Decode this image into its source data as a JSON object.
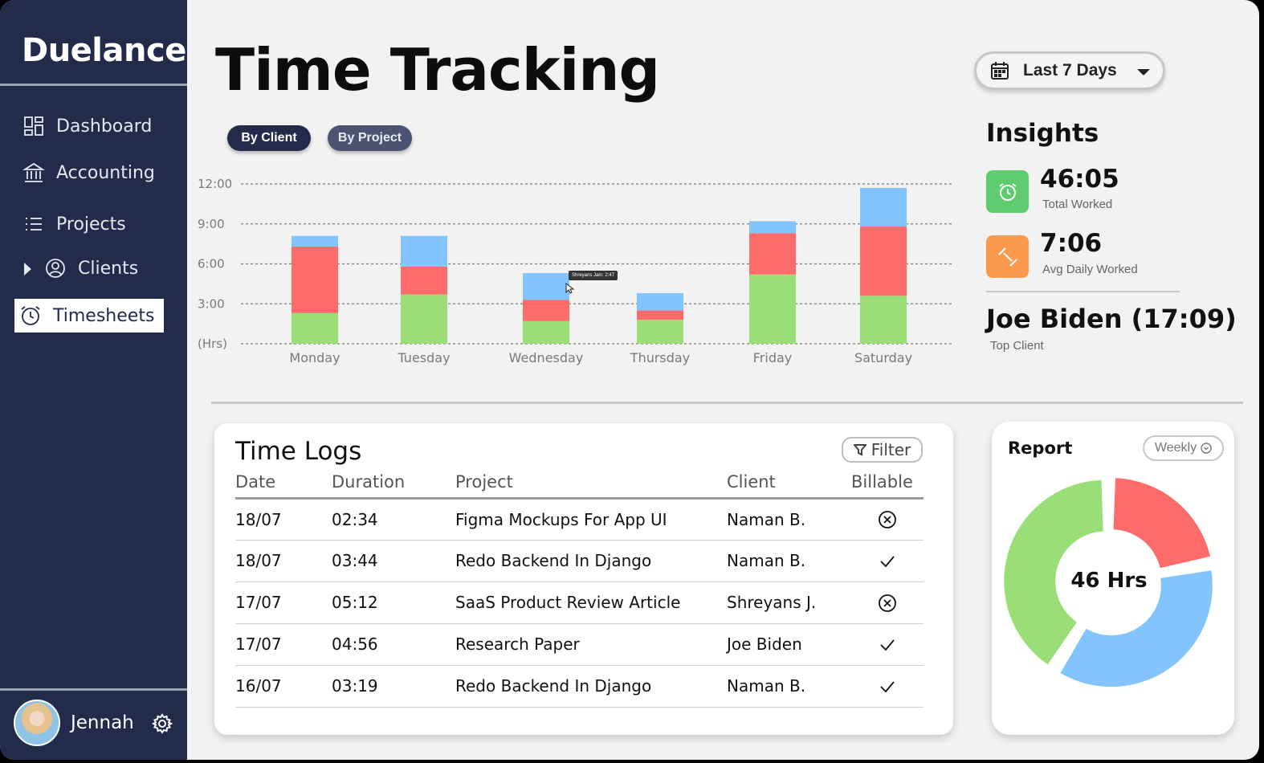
{
  "sidebar": {
    "brand": "Duelance",
    "items": [
      {
        "label": "Dashboard"
      },
      {
        "label": "Accounting"
      },
      {
        "label": "Projects"
      },
      {
        "label": "Clients"
      },
      {
        "label": "Timesheets"
      }
    ],
    "user": {
      "name": "Jennah"
    }
  },
  "header": {
    "title": "Time Tracking",
    "date_range": "Last 7 Days",
    "tabs": [
      {
        "label": "By Client",
        "active": true
      },
      {
        "label": "By Project",
        "active": false
      }
    ]
  },
  "colors": {
    "green": "#9ade78",
    "red": "#fe6b6b",
    "blue": "#82c4fe",
    "navy": "#222b4a",
    "insight_green": "#5ecb6f",
    "insight_orange": "#f99a4f"
  },
  "chart_data": {
    "type": "bar",
    "stacked": true,
    "categories": [
      "Monday",
      "Tuesday",
      "Wednesday",
      "Thursday",
      "Friday",
      "Saturday"
    ],
    "y_ticks": [
      "12:00",
      "9:00",
      "6:00",
      "3:00",
      "(Hrs)"
    ],
    "ylim": [
      0,
      12
    ],
    "grid": true,
    "series": [
      {
        "color": "#9ade78",
        "values": [
          2.3,
          3.7,
          1.7,
          1.8,
          5.2,
          3.6
        ]
      },
      {
        "color": "#fe6b6b",
        "values": [
          5.0,
          2.1,
          1.6,
          0.7,
          3.1,
          5.2
        ]
      },
      {
        "color": "#82c4fe",
        "values": [
          0.8,
          2.3,
          2.0,
          1.3,
          0.9,
          2.9
        ]
      }
    ],
    "tooltip": "Shreyans Jain: 2:47"
  },
  "insights": {
    "title": "Insights",
    "total_worked": {
      "value": "46:05",
      "label": "Total Worked"
    },
    "avg_daily": {
      "value": "7:06",
      "label": "Avg Daily Worked"
    },
    "top_client": {
      "value": "Joe Biden (17:09)",
      "label": "Top Client"
    }
  },
  "time_logs": {
    "title": "Time Logs",
    "filter_label": "Filter",
    "columns": [
      "Date",
      "Duration",
      "Project",
      "Client",
      "Billable"
    ],
    "rows": [
      {
        "date": "18/07",
        "duration": "02:34",
        "project": "Figma Mockups For App UI",
        "client": "Naman B.",
        "billable": false
      },
      {
        "date": "18/07",
        "duration": "03:44",
        "project": "Redo Backend In Django",
        "client": "Naman B.",
        "billable": true
      },
      {
        "date": "17/07",
        "duration": "05:12",
        "project": "SaaS Product Review Article",
        "client": "Shreyans J.",
        "billable": false
      },
      {
        "date": "17/07",
        "duration": "04:56",
        "project": "Research Paper",
        "client": "Joe Biden",
        "billable": true
      },
      {
        "date": "16/07",
        "duration": "03:19",
        "project": "Redo Backend In Django",
        "client": "Naman B.",
        "billable": true
      }
    ]
  },
  "report": {
    "title": "Report",
    "period": "Weekly",
    "center_label": "46 Hrs",
    "slices": [
      {
        "color": "#fe6b6b",
        "value": 22
      },
      {
        "color": "#82c4fe",
        "value": 37
      },
      {
        "color": "#9ade78",
        "value": 41
      }
    ]
  }
}
